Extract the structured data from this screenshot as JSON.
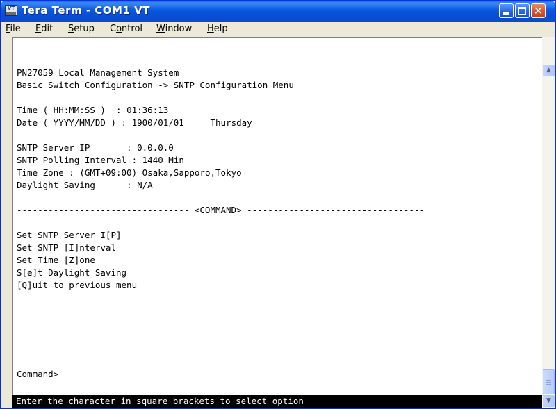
{
  "window": {
    "title": "Tera Term - COM1 VT",
    "icon_label": "VT"
  },
  "menu": [
    {
      "label": "File",
      "mnemonic": "F",
      "rest": "ile"
    },
    {
      "label": "Edit",
      "mnemonic": "E",
      "rest": "dit"
    },
    {
      "label": "Setup",
      "mnemonic": "S",
      "rest": "etup"
    },
    {
      "label": "Control",
      "prefix": "C",
      "mnemonic": "o",
      "rest": "ntrol"
    },
    {
      "label": "Window",
      "mnemonic": "W",
      "rest": "indow"
    },
    {
      "label": "Help",
      "mnemonic": "H",
      "rest": "elp"
    }
  ],
  "terminal": {
    "header": {
      "system": "PN27059 Local Management System",
      "breadcrumb": "Basic Switch Configuration -> SNTP Configuration Menu"
    },
    "time": {
      "label": "Time ( HH:MM:SS )  ",
      "value": "01:36:13"
    },
    "date": {
      "label": "Date ( YYYY/MM/DD ) ",
      "value": "1900/01/01",
      "weekday": "Thursday"
    },
    "sntp_server_ip": {
      "label": "SNTP Server IP       ",
      "value": "0.0.0.0"
    },
    "polling_interval": {
      "label": "SNTP Polling Interval ",
      "value": "1440 Min"
    },
    "time_zone": {
      "label": "Time Zone ",
      "value": "(GMT+09:00) Osaka,Sapporo,Tokyo"
    },
    "daylight_saving": {
      "label": "Daylight Saving      ",
      "value": "N/A"
    },
    "divider": "--------------------------------- <COMMAND> ----------------------------------",
    "commands": [
      "Set SNTP Server I[P]",
      "Set SNTP [I]nterval",
      "Set Time [Z]one",
      "S[e]t Daylight Saving",
      "[Q]uit to previous menu"
    ],
    "prompt": "Command>",
    "status": "Enter the character in square brackets to select option"
  },
  "colors": {
    "titlebar": "#0a58df",
    "terminal_bg": "#ffffff",
    "terminal_fg": "#000000",
    "status_bg": "#000000",
    "status_fg": "#ffffff"
  }
}
